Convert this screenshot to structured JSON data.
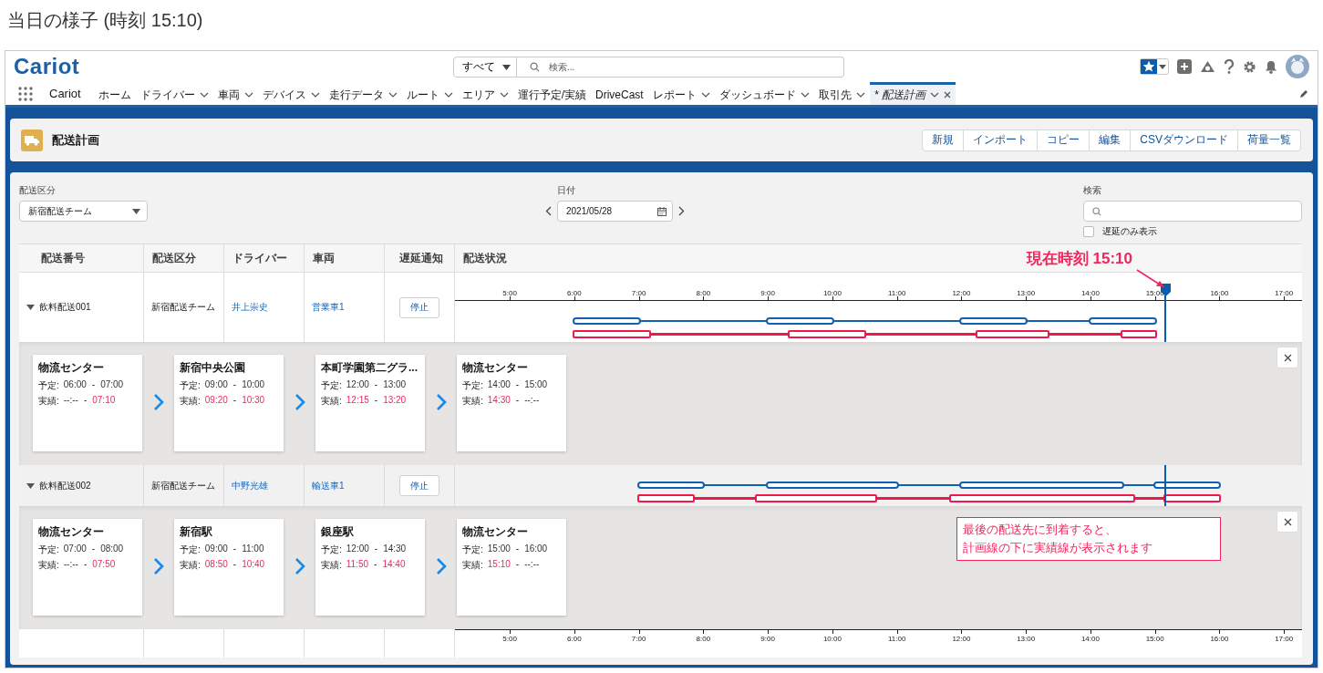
{
  "caption": "当日の様子 (時刻 15:10)",
  "topbar": {
    "logo": "Cariot",
    "search_scope": "すべて",
    "search_placeholder": "検索..."
  },
  "navbar": {
    "app_name": "Cariot",
    "tabs": [
      {
        "label": "ホーム",
        "has_menu": false,
        "selected": false,
        "closable": false
      },
      {
        "label": "ドライバー",
        "has_menu": true,
        "selected": false,
        "closable": false
      },
      {
        "label": "車両",
        "has_menu": true,
        "selected": false,
        "closable": false
      },
      {
        "label": "デバイス",
        "has_menu": true,
        "selected": false,
        "closable": false
      },
      {
        "label": "走行データ",
        "has_menu": true,
        "selected": false,
        "closable": false
      },
      {
        "label": "ルート",
        "has_menu": true,
        "selected": false,
        "closable": false
      },
      {
        "label": "エリア",
        "has_menu": true,
        "selected": false,
        "closable": false
      },
      {
        "label": "運行予定/実績",
        "has_menu": false,
        "selected": false,
        "closable": false
      },
      {
        "label": "DriveCast",
        "has_menu": false,
        "selected": false,
        "closable": false
      },
      {
        "label": "レポート",
        "has_menu": true,
        "selected": false,
        "closable": false
      },
      {
        "label": "ダッシュボード",
        "has_menu": true,
        "selected": false,
        "closable": false
      },
      {
        "label": "取引先",
        "has_menu": true,
        "selected": false,
        "closable": false
      },
      {
        "label": "* 配送計画",
        "has_menu": true,
        "selected": true,
        "closable": true
      }
    ]
  },
  "page_header": {
    "title": "配送計画",
    "buttons": [
      "新規",
      "インポート",
      "コピー",
      "編集",
      "CSVダウンロード",
      "荷量一覧"
    ]
  },
  "filters": {
    "division_label": "配送区分",
    "division_value": "新宿配送チーム",
    "date_label": "日付",
    "date_value": "2021/05/28",
    "search_label": "検索",
    "delay_only": {
      "label": "遅延のみ表示",
      "checked": false
    }
  },
  "table": {
    "columns": [
      "配送番号",
      "配送区分",
      "ドライバー",
      "車両",
      "遅延通知",
      "配送状況"
    ],
    "top_ticks": [
      "5:00",
      "6:00",
      "7:00",
      "8:00",
      "9:00",
      "10:00",
      "11:00",
      "12:00",
      "13:00",
      "14:00",
      "15:00",
      "16:00",
      "17:00"
    ],
    "bottom_ticks": [
      "5:00",
      "6:00",
      "7:00",
      "8:00",
      "9:00",
      "10:00",
      "11:00",
      "12:00",
      "13:00",
      "14:00",
      "15:00",
      "16:00",
      "17:00"
    ],
    "rows": [
      {
        "number": "飲料配送001",
        "division": "新宿配送チーム",
        "driver": "井上崇史",
        "vehicle": "営業車1",
        "notify_button": "停止",
        "expanded": true,
        "stops": [
          {
            "name": "物流センター",
            "plan_label": "予定:",
            "plan_start": "06:00",
            "plan_sep": "-",
            "plan_end": "07:00",
            "actual_label": "実績:",
            "actual_start": {
              "time": "--:--",
              "recorded": false
            },
            "actual_sep": "-",
            "actual_end": {
              "time": "07:10",
              "recorded": true
            }
          },
          {
            "name": "新宿中央公園",
            "plan_label": "予定:",
            "plan_start": "09:00",
            "plan_sep": "-",
            "plan_end": "10:00",
            "actual_label": "実績:",
            "actual_start": {
              "time": "09:20",
              "recorded": true
            },
            "actual_sep": "-",
            "actual_end": {
              "time": "10:30",
              "recorded": true
            }
          },
          {
            "name": "本町学園第二グラ...",
            "plan_label": "予定:",
            "plan_start": "12:00",
            "plan_sep": "-",
            "plan_end": "13:00",
            "actual_label": "実績:",
            "actual_start": {
              "time": "12:15",
              "recorded": true
            },
            "actual_sep": "-",
            "actual_end": {
              "time": "13:20",
              "recorded": true
            }
          },
          {
            "name": "物流センター",
            "plan_label": "予定:",
            "plan_start": "14:00",
            "plan_sep": "-",
            "plan_end": "15:00",
            "actual_label": "実績:",
            "actual_start": {
              "time": "14:30",
              "recorded": true
            },
            "actual_sep": "-",
            "actual_end": {
              "time": "--:--",
              "recorded": false
            }
          }
        ]
      },
      {
        "number": "飲料配送002",
        "division": "新宿配送チーム",
        "driver": "中野光雄",
        "vehicle": "輸送車1",
        "notify_button": "停止",
        "expanded": true,
        "stops": [
          {
            "name": "物流センター",
            "plan_label": "予定:",
            "plan_start": "07:00",
            "plan_sep": "-",
            "plan_end": "08:00",
            "actual_label": "実績:",
            "actual_start": {
              "time": "--:--",
              "recorded": false
            },
            "actual_sep": "-",
            "actual_end": {
              "time": "07:50",
              "recorded": true
            }
          },
          {
            "name": "新宿駅",
            "plan_label": "予定:",
            "plan_start": "09:00",
            "plan_sep": "-",
            "plan_end": "11:00",
            "actual_label": "実績:",
            "actual_start": {
              "time": "08:50",
              "recorded": true
            },
            "actual_sep": "-",
            "actual_end": {
              "time": "10:40",
              "recorded": true
            }
          },
          {
            "name": "銀座駅",
            "plan_label": "予定:",
            "plan_start": "12:00",
            "plan_sep": "-",
            "plan_end": "14:30",
            "actual_label": "実績:",
            "actual_start": {
              "time": "11:50",
              "recorded": true
            },
            "actual_sep": "-",
            "actual_end": {
              "time": "14:40",
              "recorded": true
            }
          },
          {
            "name": "物流センター",
            "plan_label": "予定:",
            "plan_start": "15:00",
            "plan_sep": "-",
            "plan_end": "16:00",
            "actual_label": "実績:",
            "actual_start": {
              "time": "15:10",
              "recorded": true
            },
            "actual_sep": "-",
            "actual_end": {
              "time": "--:--",
              "recorded": false
            }
          }
        ]
      }
    ]
  },
  "annotations": {
    "current_time_label": "現在時刻 15:10",
    "callout_lines": [
      "最後の配送先に到着すると、",
      "計画線の下に実績線が表示されます"
    ]
  }
}
